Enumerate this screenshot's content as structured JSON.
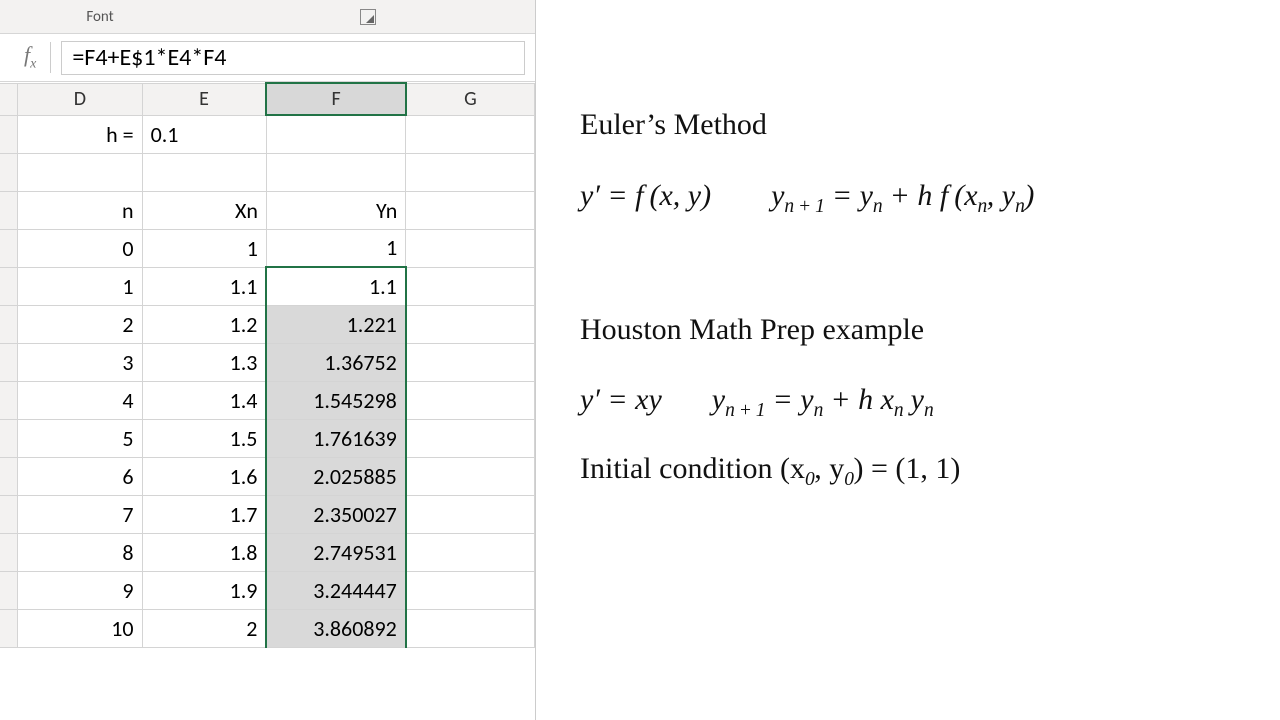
{
  "ribbon": {
    "group_font": "Font"
  },
  "formula_bar": {
    "fx_label": "f",
    "fx_sub": "x",
    "formula": "=F4+E$1*E4*F4"
  },
  "columns": {
    "D": "D",
    "E": "E",
    "F": "F",
    "G": "G"
  },
  "sheet": {
    "h_label": "h =",
    "h_value": "0.1",
    "headers": {
      "n": "n",
      "xn": "Xn",
      "yn": "Yn"
    },
    "rows": [
      {
        "n": "0",
        "xn": "1",
        "yn": "1"
      },
      {
        "n": "1",
        "xn": "1.1",
        "yn": "1.1"
      },
      {
        "n": "2",
        "xn": "1.2",
        "yn": "1.221"
      },
      {
        "n": "3",
        "xn": "1.3",
        "yn": "1.36752"
      },
      {
        "n": "4",
        "xn": "1.4",
        "yn": "1.545298"
      },
      {
        "n": "5",
        "xn": "1.5",
        "yn": "1.761639"
      },
      {
        "n": "6",
        "xn": "1.6",
        "yn": "2.025885"
      },
      {
        "n": "7",
        "xn": "1.7",
        "yn": "2.350027"
      },
      {
        "n": "8",
        "xn": "1.8",
        "yn": "2.749531"
      },
      {
        "n": "9",
        "xn": "1.9",
        "yn": "3.244447"
      },
      {
        "n": "10",
        "xn": "2",
        "yn": "3.860892"
      }
    ]
  },
  "notes": {
    "title": "Euler’s Method",
    "eq1a": "y′ = f (x, y)",
    "eq1b_pre": "y",
    "eq1b_sub1": "n + 1",
    "eq1b_mid": " = y",
    "eq1b_sub2": "n",
    "eq1b_mid2": " + h f (x",
    "eq1b_sub3": "n",
    "eq1b_mid3": ", y",
    "eq1b_sub4": "n",
    "eq1b_end": ")",
    "subtitle": "Houston Math Prep example",
    "eq2a": "y′ = xy",
    "eq2b_pre": "y",
    "eq2b_sub1": "n + 1",
    "eq2b_mid": " = y",
    "eq2b_sub2": "n",
    "eq2b_mid2": " + h x",
    "eq2b_sub3": "n",
    "eq2b_mid3": " y",
    "eq2b_sub4": "n",
    "ic_pre": "Initial condition (x",
    "ic_sub1": "0",
    "ic_mid": ", y",
    "ic_sub2": "0",
    "ic_end": ") = (1, 1)"
  }
}
